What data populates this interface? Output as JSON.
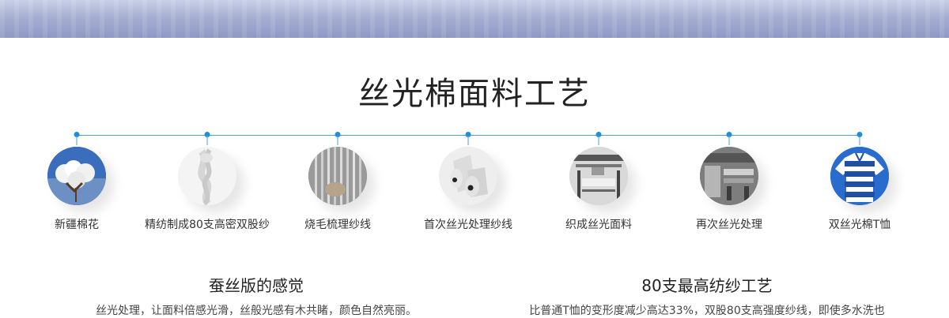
{
  "page": {
    "title": "丝光棉面料工艺",
    "accent_color": "#1d8fd6"
  },
  "steps": [
    {
      "label": "新疆棉花",
      "icon": "cotton-boll-icon"
    },
    {
      "label": "精纺制成80支高密双股纱",
      "icon": "yarn-skein-icon"
    },
    {
      "label": "烧毛梳理纱线",
      "icon": "yarn-threads-icon"
    },
    {
      "label": "首次丝光处理纱线",
      "icon": "thread-spools-icon"
    },
    {
      "label": "织成丝光面料",
      "icon": "weaving-machine-icon"
    },
    {
      "label": "再次丝光处理",
      "icon": "factory-machine-icon"
    },
    {
      "label": "双丝光棉T恤",
      "icon": "striped-tshirt-icon"
    }
  ],
  "features": [
    {
      "heading": "蚕丝版的感觉",
      "text": "丝光处理，让面料倍感光滑，丝般光感有木共睹，颜色自然亮丽。"
    },
    {
      "heading": "80支最高纺纱工艺",
      "text": "比普通T恤的变形度减少高达33%，双股80支高强度纱线，即使多水洗也"
    }
  ]
}
